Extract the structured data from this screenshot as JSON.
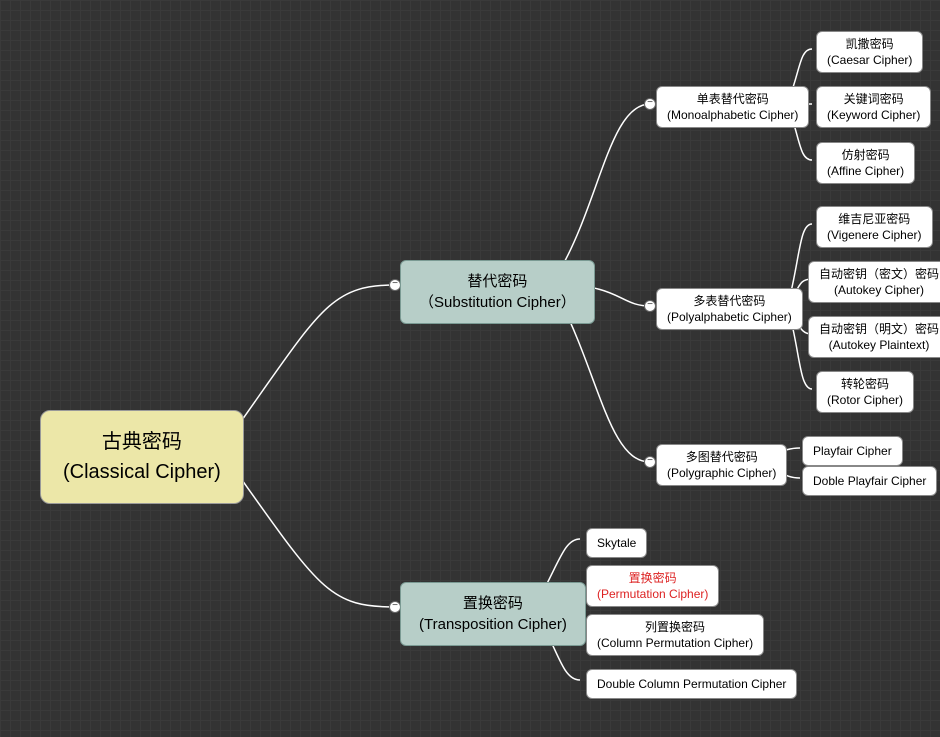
{
  "root": {
    "title_zh": "古典密码",
    "title_en": "(Classical Cipher)"
  },
  "branches": {
    "substitution": {
      "zh": "替代密码",
      "en": "（Substitution Cipher）"
    },
    "transposition": {
      "zh": "置换密码",
      "en": "(Transposition Cipher)"
    }
  },
  "sub": {
    "mono": {
      "zh": "单表替代密码",
      "en": "(Monoalphabetic Cipher)"
    },
    "poly": {
      "zh": "多表替代密码",
      "en": "(Polyalphabetic Cipher)"
    },
    "graphic": {
      "zh": "多图替代密码",
      "en": "(Polygraphic Cipher)"
    }
  },
  "leaves": {
    "caesar": {
      "zh": "凯撒密码",
      "en": "(Caesar Cipher)"
    },
    "keyword": {
      "zh": "关键词密码",
      "en": "(Keyword Cipher)"
    },
    "affine": {
      "zh": "仿射密码",
      "en": "(Affine Cipher)"
    },
    "vigenere": {
      "zh": "维吉尼亚密码",
      "en": "(Vigenere Cipher)"
    },
    "autokey": {
      "zh": "自动密钥（密文）密码",
      "en": "(Autokey Cipher)"
    },
    "autokey_plain": {
      "zh": "自动密钥（明文）密码",
      "en": "(Autokey Plaintext)"
    },
    "rotor": {
      "zh": "转轮密码",
      "en": "(Rotor Cipher)"
    },
    "playfair": {
      "single": "Playfair Cipher"
    },
    "doble_playfair": {
      "single": "Doble Playfair Cipher"
    },
    "skytale": {
      "single": "Skytale"
    },
    "permutation": {
      "zh": "置换密码",
      "en": "(Permutation Cipher)"
    },
    "column_perm": {
      "zh": "列置换密码",
      "en": "(Column Permutation Cipher)"
    },
    "double_column": {
      "single": "Double Column Permutation Cipher"
    }
  }
}
